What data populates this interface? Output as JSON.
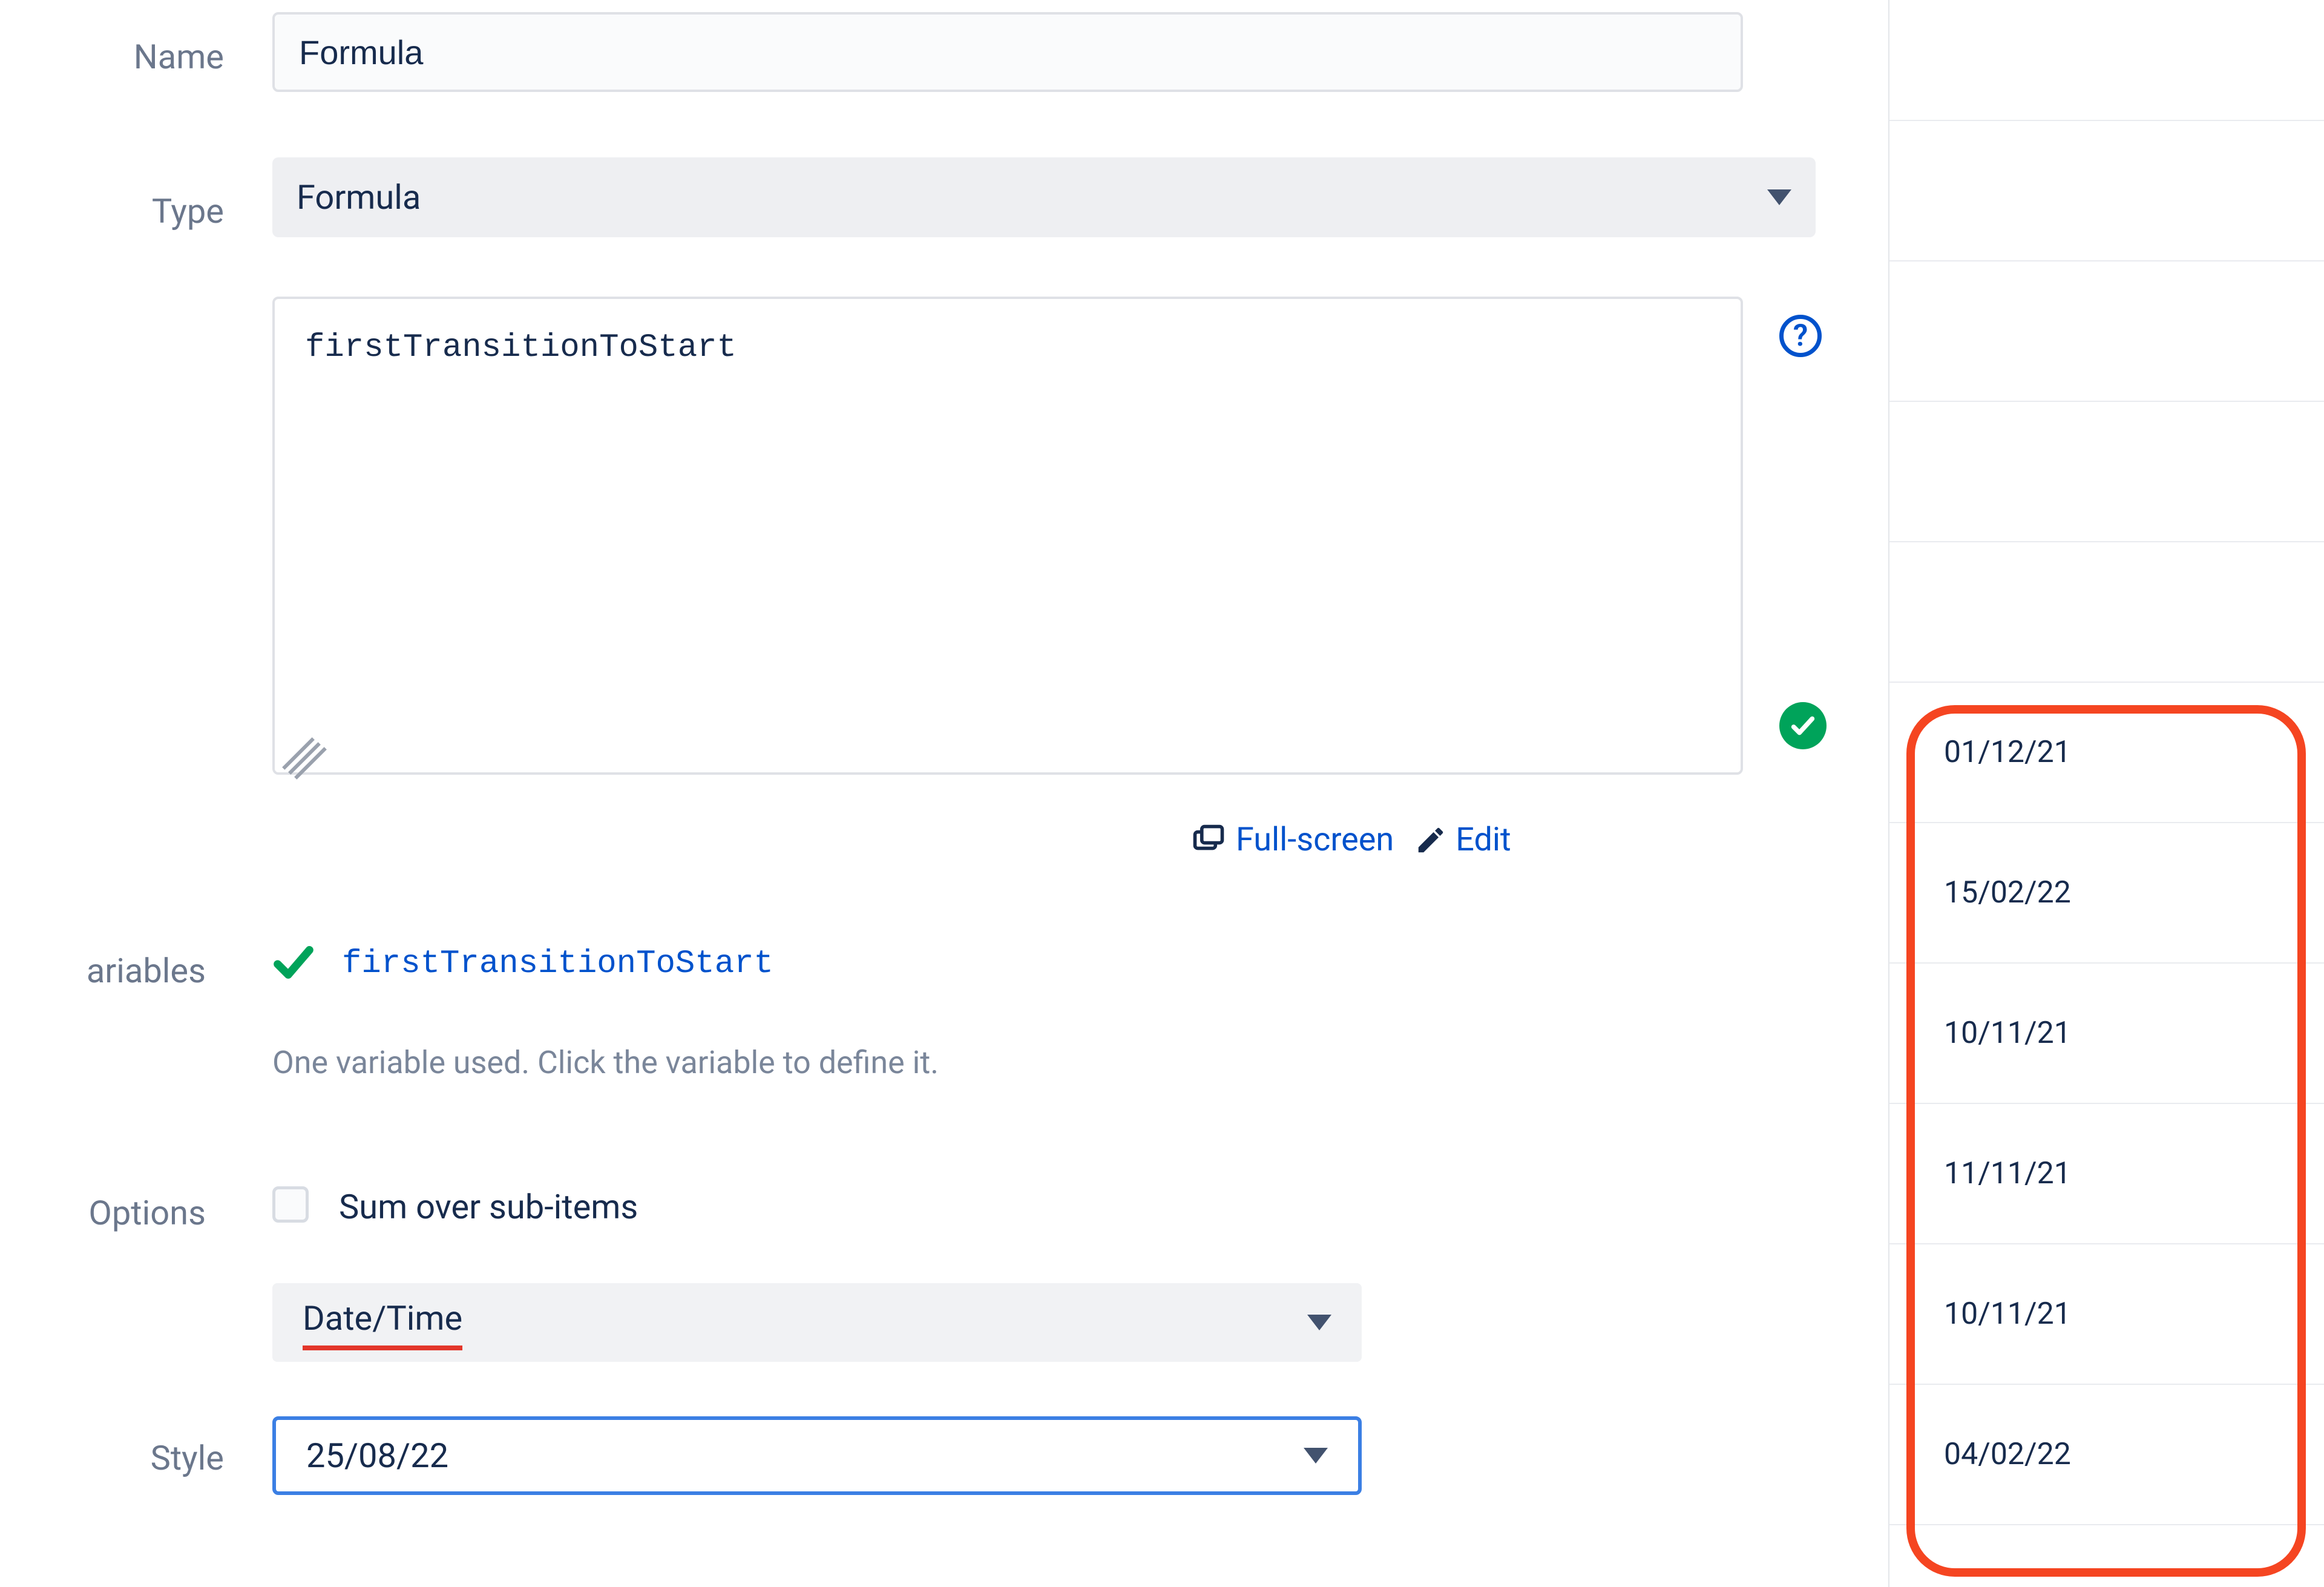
{
  "labels": {
    "name": "Name",
    "type": "Type",
    "variables": "ariables",
    "options": "Options",
    "style": "Style"
  },
  "name_field": {
    "value": "Formula"
  },
  "type_select": {
    "value": "Formula"
  },
  "formula": {
    "value": "firstTransitionToStart"
  },
  "editor_actions": {
    "fullscreen": "Full-screen",
    "edit": "Edit"
  },
  "variable": {
    "name": "firstTransitionToStart",
    "hint": "One variable used. Click the variable to define it."
  },
  "options_checkbox": {
    "label": "Sum over sub-items",
    "checked": false
  },
  "datetime_select": {
    "value": "Date/Time"
  },
  "style_select": {
    "value": "25/08/22"
  },
  "data_values": [
    "01/12/21",
    "15/02/22",
    "10/11/21",
    "11/11/21",
    "10/11/21",
    "04/02/22"
  ]
}
